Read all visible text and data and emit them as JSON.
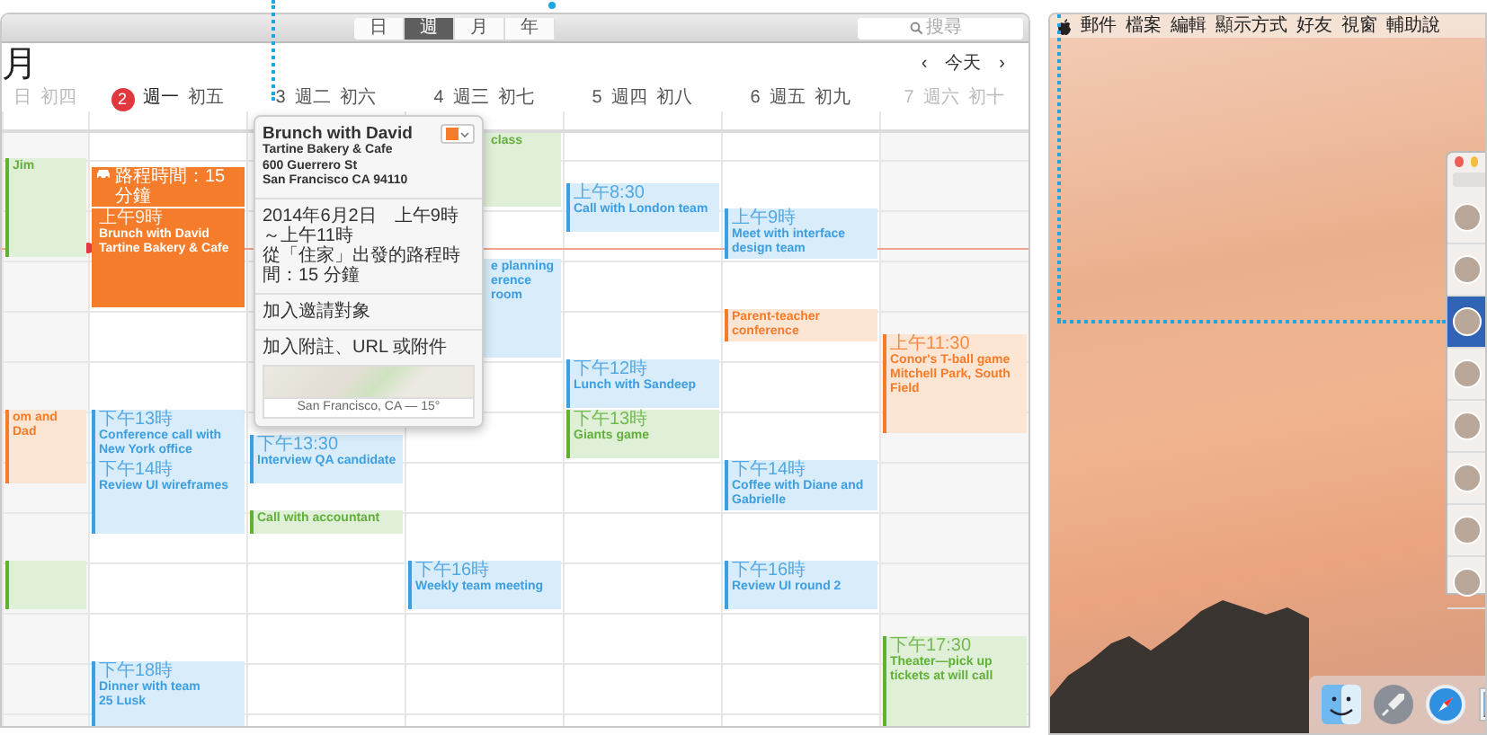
{
  "calendar": {
    "view_switcher": [
      {
        "label": "日",
        "selected": false
      },
      {
        "label": "週",
        "selected": true
      },
      {
        "label": "月",
        "selected": false
      },
      {
        "label": "年",
        "selected": false
      }
    ],
    "search": {
      "placeholder": "搜尋"
    },
    "month_title": "月",
    "nav": {
      "prev": "‹",
      "today": "今天",
      "next": "›"
    },
    "days": [
      {
        "weekday": "日",
        "lunar": "初四",
        "today": false,
        "weekend": true,
        "events": [
          {
            "color": "#62b03a",
            "title": "Jim",
            "selected": false
          },
          {
            "color": "#f47c2a",
            "title": "om and Dad",
            "selected": false
          },
          {
            "color": "#62b03a",
            "selected": false
          }
        ]
      },
      {
        "number": "2",
        "weekday": "週一",
        "lunar": "初五",
        "today": true,
        "weekend": false,
        "events": [
          {
            "color": "#f47c2a",
            "time": "上午9時",
            "title": "Brunch with David",
            "location": "Tartine Bakery & Cafe",
            "travel": "路程時間：15 分鐘",
            "selected": true
          },
          {
            "color": "#3d9ee0",
            "time": "下午13時",
            "title": "Conference call with New York office",
            "selected": false
          },
          {
            "color": "#3d9ee0",
            "time": "下午14時",
            "title": "Review UI wireframes",
            "selected": false
          },
          {
            "color": "#3d9ee0",
            "time": "下午18時",
            "title": "Dinner with team",
            "location": "25 Lusk",
            "selected": false
          }
        ]
      },
      {
        "number": "3",
        "weekday": "週二",
        "lunar": "初六",
        "today": false,
        "weekend": false,
        "events": [
          {
            "color": "#3d9ee0",
            "time": "下午13:30",
            "title": "Interview QA candidate",
            "selected": false
          },
          {
            "color": "#62b03a",
            "title": "Call with accountant",
            "selected": false
          }
        ]
      },
      {
        "number": "4",
        "weekday": "週三",
        "lunar": "初七",
        "today": false,
        "weekend": false,
        "events": [
          {
            "color": "#62b03a",
            "title": "class",
            "selected": false,
            "under_popover": true
          },
          {
            "color": "#3d9ee0",
            "title": "e planning",
            "location": "erence room",
            "selected": false,
            "under_popover": true
          },
          {
            "color": "#3d9ee0",
            "time": "下午16時",
            "title": "Weekly team meeting",
            "selected": false
          }
        ]
      },
      {
        "number": "5",
        "weekday": "週四",
        "lunar": "初八",
        "today": false,
        "weekend": false,
        "events": [
          {
            "color": "#3d9ee0",
            "time": "上午8:30",
            "title": "Call with London team",
            "selected": false
          },
          {
            "color": "#3d9ee0",
            "time": "下午12時",
            "title": "Lunch with Sandeep",
            "selected": false
          },
          {
            "color": "#62b03a",
            "time": "下午13時",
            "title": "Giants game",
            "selected": false
          }
        ]
      },
      {
        "number": "6",
        "weekday": "週五",
        "lunar": "初九",
        "today": false,
        "weekend": false,
        "events": [
          {
            "color": "#3d9ee0",
            "time": "上午9時",
            "title": "Meet with interface design team",
            "selected": false
          },
          {
            "color": "#f47c2a",
            "title": "Parent-teacher conference",
            "selected": false
          },
          {
            "color": "#3d9ee0",
            "time": "下午14時",
            "title": "Coffee with Diane and Gabrielle",
            "selected": false
          },
          {
            "color": "#3d9ee0",
            "time": "下午16時",
            "title": "Review UI round 2",
            "selected": false
          }
        ]
      },
      {
        "number": "7",
        "weekday": "週六",
        "lunar": "初十",
        "today": false,
        "weekend": true,
        "events": [
          {
            "color": "#f47c2a",
            "time": "上午11:30",
            "title": "Conor's T-ball game",
            "location": "Mitchell Park, South Field",
            "selected": false
          },
          {
            "color": "#62b03a",
            "time": "下午17:30",
            "title": "Theater—pick up tickets at will call",
            "selected": false
          }
        ]
      }
    ],
    "popover": {
      "title": "Brunch with David",
      "color": "#f47c2a",
      "address": [
        "Tartine Bakery & Cafe",
        "600 Guerrero St",
        "San Francisco CA 94110"
      ],
      "when": "2014年6月2日　上午9時～上午11時",
      "travel": "從「住家」出發的路程時間：15 分鐘",
      "invitees": "加入邀請對象",
      "notes": "加入附註、URL 或附件",
      "map_caption": "San Francisco, CA — 15°"
    }
  },
  "desktop": {
    "menu_bar": [
      "郵件",
      "檔案",
      "編輯",
      "顯示方式",
      "好友",
      "視窗",
      "輔助說"
    ],
    "contacts": [
      {
        "selected": false
      },
      {
        "selected": false
      },
      {
        "selected": true
      },
      {
        "selected": false
      },
      {
        "selected": false
      },
      {
        "selected": false
      },
      {
        "selected": false
      },
      {
        "selected": false
      }
    ]
  }
}
